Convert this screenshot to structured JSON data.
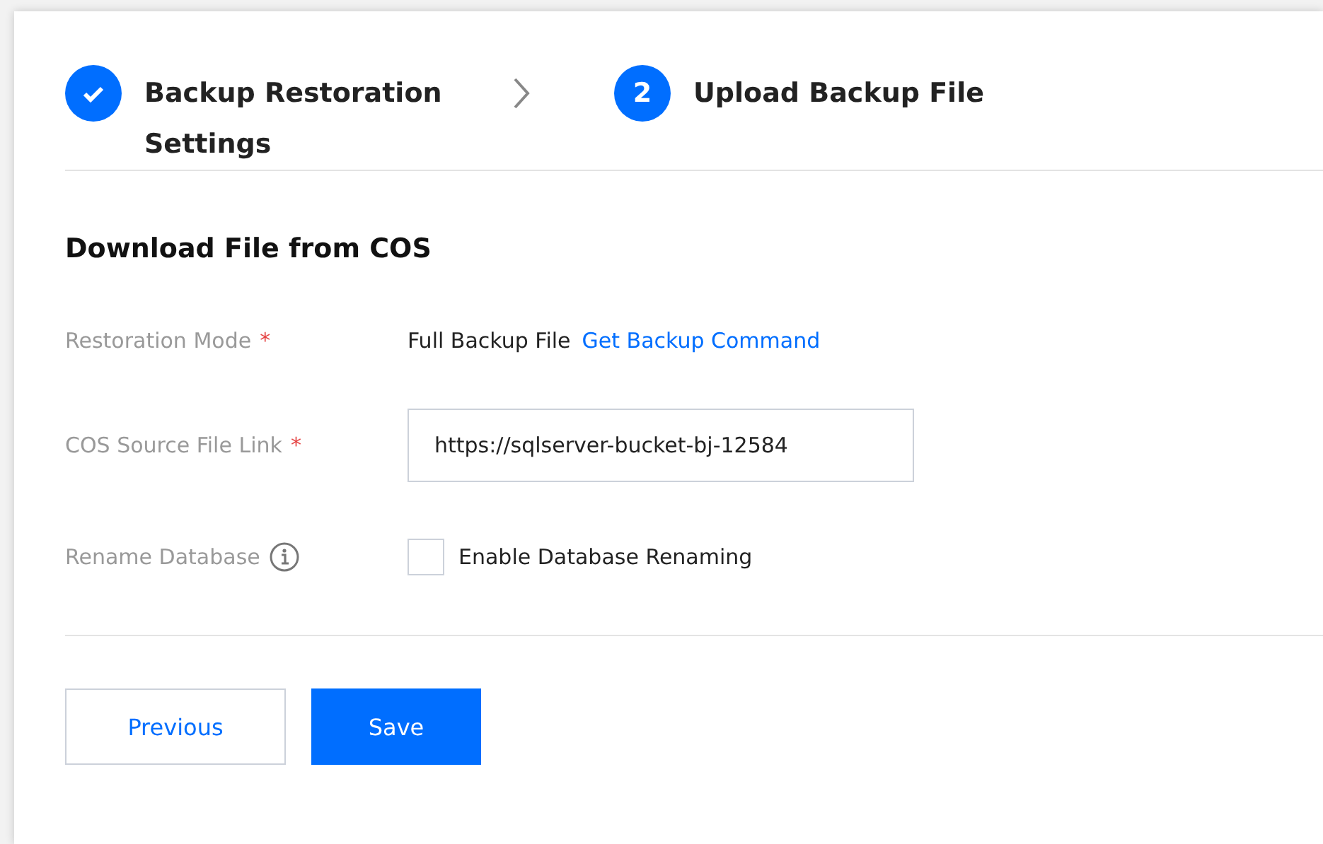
{
  "steps": [
    {
      "kind": "done",
      "label": "Backup Restoration Settings"
    },
    {
      "kind": "current",
      "number": "2",
      "label": "Upload Backup File"
    }
  ],
  "section_title": "Download File from COS",
  "form": [
    {
      "kind": "text",
      "label": "Restoration Mode",
      "required_mark": "*",
      "value": "Full Backup File",
      "link": "Get Backup Command"
    },
    {
      "kind": "input",
      "label": "COS Source File Link",
      "required_mark": "*",
      "value": "https://sqlserver-bucket-bj-12584"
    },
    {
      "kind": "checkbox",
      "label": "Rename Database",
      "info": true,
      "option": "Enable Database Renaming",
      "checked": false
    }
  ],
  "buttons": [
    {
      "kind": "secondary",
      "label": "Previous"
    },
    {
      "kind": "primary",
      "label": "Save"
    }
  ]
}
